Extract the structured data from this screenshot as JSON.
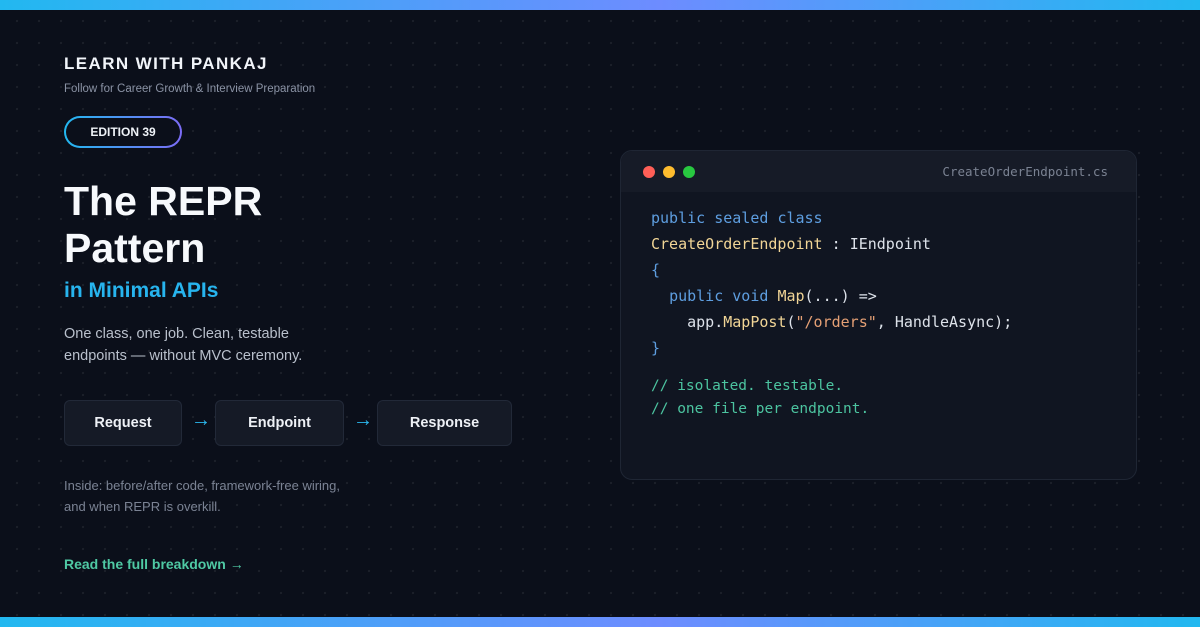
{
  "brand": {
    "name": "LEARN WITH PANKAJ",
    "tagline": "Follow for Career Growth & Interview Preparation"
  },
  "edition": "EDITION 39",
  "title_line1": "The REPR",
  "title_line2": "Pattern",
  "subtitle": "in Minimal APIs",
  "description_line1": "One class, one job. Clean, testable",
  "description_line2": "endpoints — without MVC ceremony.",
  "flow": {
    "steps": [
      "Request",
      "Endpoint",
      "Response"
    ],
    "arrow": "→"
  },
  "inside_line1": "Inside: before/after code, framework-free wiring,",
  "inside_line2": "and when REPR is overkill.",
  "cta": "Read the full breakdown →",
  "code_card": {
    "filename": "CreateOrderEndpoint.cs",
    "tokens": {
      "public": "public",
      "sealed": "sealed",
      "class": "class",
      "class_name": "CreateOrderEndpoint",
      "colon": " : ",
      "interface": "IEndpoint",
      "open_brace": "{",
      "void": "void",
      "method": "Map",
      "params": "(...) =>",
      "app": "app.",
      "mappost": "MapPost",
      "paren_open": "(",
      "route": "\"/orders\"",
      "rest": ", HandleAsync);",
      "close_brace": "}"
    },
    "comments": [
      "// isolated. testable.",
      "// one file per endpoint."
    ]
  },
  "colors": {
    "background": "#0b0f1a",
    "accent_blue": "#27b4ee",
    "accent_green": "#4fc9a4",
    "gradient_purple": "#7c6cf6"
  }
}
